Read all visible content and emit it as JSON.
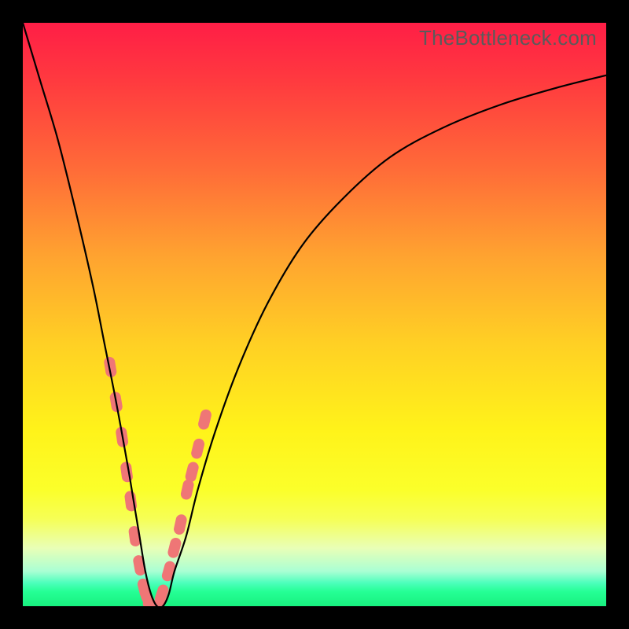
{
  "watermark": "TheBottleneck.com",
  "colors": {
    "frame": "#000000",
    "curve": "#000000",
    "marker": "#ef7676"
  },
  "chart_data": {
    "type": "line",
    "title": "",
    "xlabel": "",
    "ylabel": "",
    "xlim": [
      0,
      100
    ],
    "ylim": [
      0,
      100
    ],
    "grid": false,
    "legend": false,
    "series": [
      {
        "name": "bottleneck-curve",
        "x": [
          0,
          3,
          6,
          9,
          12,
          14,
          16,
          18,
          19,
          20,
          21,
          22,
          23,
          24,
          25,
          26,
          28,
          30,
          33,
          37,
          42,
          48,
          55,
          63,
          72,
          82,
          92,
          100
        ],
        "y": [
          100,
          90,
          80,
          68,
          55,
          45,
          35,
          24,
          18,
          12,
          6,
          2,
          0,
          0,
          2,
          6,
          12,
          20,
          30,
          41,
          52,
          62,
          70,
          77,
          82,
          86,
          89,
          91
        ]
      }
    ],
    "markers": {
      "name": "highlight-range",
      "x": [
        15.0,
        16.0,
        17.0,
        17.8,
        18.5,
        19.2,
        20.0,
        20.8,
        21.5,
        22.2,
        23.0,
        23.8,
        25.0,
        26.0,
        27.0,
        28.2,
        29.0,
        30.0,
        31.2
      ],
      "y": [
        41.0,
        35.0,
        29.0,
        23.0,
        18.0,
        12.0,
        7.0,
        3.0,
        1.0,
        0.0,
        0.0,
        2.0,
        6.0,
        10.0,
        14.0,
        20.0,
        23.0,
        27.0,
        32.0
      ]
    }
  }
}
